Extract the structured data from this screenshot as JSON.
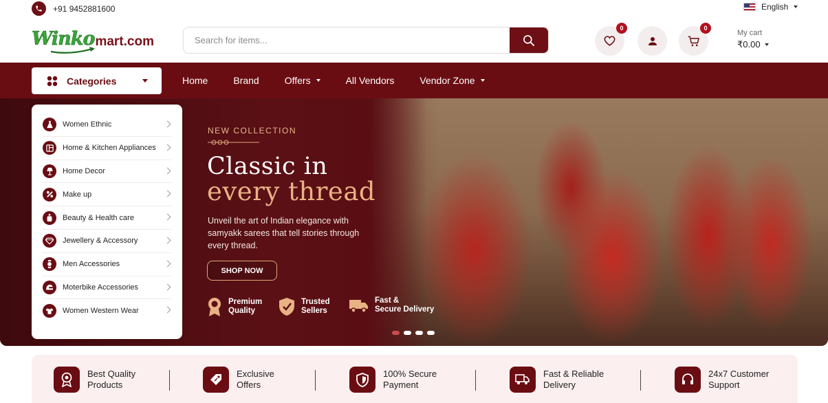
{
  "topbar": {
    "phone": "+91 9452881600",
    "language": "English"
  },
  "logo": {
    "part1": "Winko",
    "part2": "mart.com"
  },
  "search": {
    "placeholder": "Search for items..."
  },
  "header": {
    "wishlist_count": "0",
    "cart_count": "0",
    "cart_label": "My cart",
    "cart_amount": "₹0.00"
  },
  "nav": {
    "categories_label": "Categories",
    "items": [
      "Home",
      "Brand",
      "Offers",
      "All Vendors",
      "Vendor Zone"
    ]
  },
  "categories": [
    {
      "label": "Women Ethnic",
      "icon": "dress-icon"
    },
    {
      "label": "Home & Kitchen Appliances",
      "icon": "appliance-icon"
    },
    {
      "label": "Home Decor",
      "icon": "lamp-icon"
    },
    {
      "label": "Make up",
      "icon": "makeup-icon"
    },
    {
      "label": "Beauty & Health care",
      "icon": "bottle-icon"
    },
    {
      "label": "Jewellery & Accessory",
      "icon": "diamond-icon"
    },
    {
      "label": "Men Accessories",
      "icon": "watch-icon"
    },
    {
      "label": "Moterbike Accessories",
      "icon": "helmet-icon"
    },
    {
      "label": "Women Western Wear",
      "icon": "tshirt-icon"
    }
  ],
  "hero": {
    "eyebrow": "NEW COLLECTION",
    "headline_line1": "Classic in",
    "headline_line2": "every thread",
    "description": "Unveil the art of Indian elegance with samyakk sarees that tell stories through every thread.",
    "cta": "SHOP NOW",
    "features": [
      {
        "line1": "Premium",
        "line2": "Quality",
        "icon": "award-icon"
      },
      {
        "line1": "Trusted",
        "line2": "Sellers",
        "icon": "shield-check-icon"
      },
      {
        "line1": "Fast &",
        "line2": "Secure Delivery",
        "icon": "truck-icon"
      }
    ],
    "slide_count": 4,
    "active_slide": 1
  },
  "features_strip": [
    {
      "line1": "Best Quality",
      "line2": "Products",
      "icon": "quality-badge-icon"
    },
    {
      "line1": "Exclusive",
      "line2": "Offers",
      "icon": "tag-icon"
    },
    {
      "line1": "100% Secure",
      "line2": "Payment",
      "icon": "shield-icon"
    },
    {
      "line1": "Fast & Reliable",
      "line2": "Delivery",
      "icon": "truck-icon"
    },
    {
      "line1": "24x7 Customer",
      "line2": "Support",
      "icon": "headset-icon"
    }
  ],
  "colors": {
    "brand": "#6a0d13",
    "accent": "#e9b285",
    "badge": "#b0121f",
    "logo_green": "#3aa53a"
  }
}
